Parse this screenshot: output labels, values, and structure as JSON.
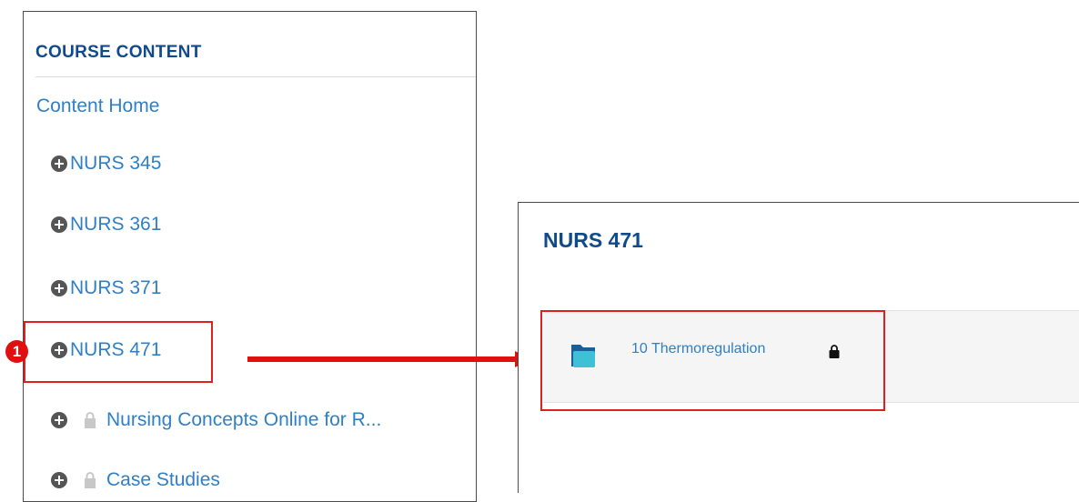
{
  "course_content": {
    "title": "COURSE CONTENT",
    "content_home": "Content Home",
    "items": [
      {
        "label": "NURS 345"
      },
      {
        "label": "NURS 361"
      },
      {
        "label": "NURS 371"
      },
      {
        "label": "NURS 471"
      },
      {
        "label": "Nursing Concepts Online for R..."
      },
      {
        "label": "Case Studies"
      }
    ]
  },
  "callout": {
    "step_number": "1"
  },
  "module_panel": {
    "title": "NURS 471",
    "folder_label": "10 Thermoregulation"
  },
  "colors": {
    "link": "#2f7fc6",
    "heading": "#104a8c",
    "highlight": "#e02020",
    "folder": "#3ec0d6"
  },
  "icons": {
    "expand": "plus-circle-icon",
    "lock": "lock-icon",
    "folder": "folder-icon",
    "arrow": "arrow-right-icon"
  }
}
